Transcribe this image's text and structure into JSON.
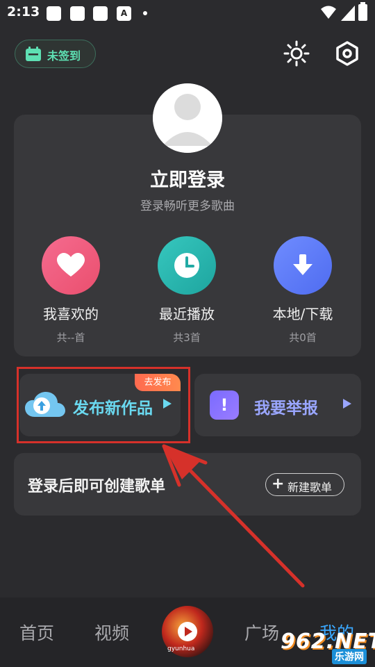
{
  "status_bar": {
    "time": "2:13",
    "notification_a": "A",
    "icons": [
      "wifi-icon",
      "signal-icon",
      "battery-icon"
    ]
  },
  "top_bar": {
    "checkin_label": "未签到",
    "icons": [
      "calendar-icon",
      "sun-icon",
      "settings-icon"
    ]
  },
  "profile": {
    "title": "立即登录",
    "subtitle": "登录畅听更多歌曲",
    "quick_actions": [
      {
        "label": "我喜欢的",
        "count": "共--首",
        "icon": "heart-icon",
        "color": "#f0567a"
      },
      {
        "label": "最近播放",
        "count": "共3首",
        "icon": "clock-icon",
        "color": "#2ab7b0"
      },
      {
        "label": "本地/下载",
        "count": "共0首",
        "icon": "download-icon",
        "color": "#5b7cf5"
      }
    ]
  },
  "publish": {
    "label": "发布新作品",
    "badge": "去发布",
    "icon": "cloud-upload-icon"
  },
  "report": {
    "label": "我要举报",
    "icon_glyph": "!"
  },
  "playlist": {
    "text": "登录后即可创建歌单",
    "button_label": "新建歌单",
    "button_plus": "+"
  },
  "bottom_nav": {
    "items": [
      {
        "label": "首页"
      },
      {
        "label": "视频"
      },
      {
        "label": "广场"
      },
      {
        "label": "我的"
      }
    ],
    "active": "我的",
    "disc_text": "gyunhua"
  },
  "watermark": {
    "main": "962.NET",
    "sub": "乐游网"
  },
  "colors": {
    "background": "#2b2b2e",
    "card": "#38383b",
    "accent_green": "#5ee0b3",
    "accent_blue": "#3aa8ff",
    "highlight_red": "#d6312a"
  }
}
